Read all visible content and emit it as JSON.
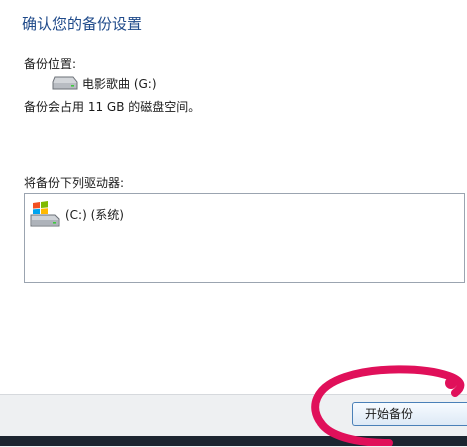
{
  "dialog": {
    "heading": "确认您的备份设置",
    "location_label": "备份位置:",
    "target_drive": "电影歌曲 (G:)",
    "space_note": "备份会占用 11 GB 的磁盘空间。",
    "drives_label": "将备份下列驱动器:",
    "drives": [
      {
        "label": "(C:) (系统)",
        "icon": "windows-drive-icon"
      }
    ]
  },
  "footer": {
    "start_button_label": "开始备份"
  },
  "annotation": {
    "highlight_color": "#e0105a"
  }
}
